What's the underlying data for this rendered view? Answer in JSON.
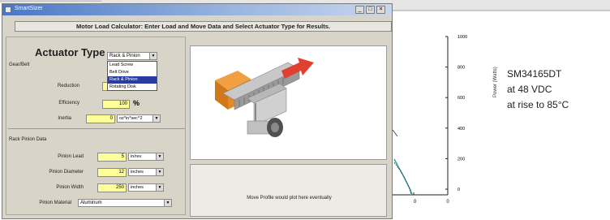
{
  "background_chart": {
    "y_ticks": [
      "1000",
      "800",
      "600",
      "400",
      "200",
      "0"
    ],
    "x_ticks": [
      "0",
      "0"
    ],
    "ylabel": "Power (Watts)",
    "motor_text": [
      "SM34165DT",
      "at 48 VDC",
      "at rise to 85°C"
    ],
    "colors": {
      "curve_teal": "#2aa0a8",
      "curve_dark": "#333333"
    }
  },
  "window": {
    "title": "SmartSizer",
    "controls": {
      "minimize": "_",
      "maximize": "□",
      "close": "×"
    }
  },
  "banner": "Motor Load Calculator: Enter Load and Move Data and Select Actuator Type for Results.",
  "actuator": {
    "label": "Actuator Type",
    "selected": "Rack & Pinion",
    "options": [
      "Lead Screw",
      "Belt Drive",
      "Rack & Pinion",
      "Rotating Disk"
    ]
  },
  "gearbox": {
    "section_label": "Gear/Belt",
    "reduction_label": "Reduction",
    "reduction_value": "1",
    "efficiency_label": "Efficiency",
    "efficiency_value": "100",
    "efficiency_unit": "%",
    "inertia_label": "Inertia",
    "inertia_value": "0",
    "inertia_unit": "oz*in*sec^2"
  },
  "rack_pinion": {
    "section_label": "Rack Pinion Data",
    "lead_label": "Pinion Lead",
    "lead_value": "5",
    "lead_unit": "in/rev",
    "diameter_label": "Pinion Diameter",
    "diameter_value": "12",
    "diameter_unit": "inches",
    "width_label": "Pinion Width",
    "width_value": "250",
    "width_unit": "inches",
    "material_label": "Pinion Material",
    "material_value": "Aluminum"
  },
  "move_profile_message": "Move Profile would plot here eventually"
}
